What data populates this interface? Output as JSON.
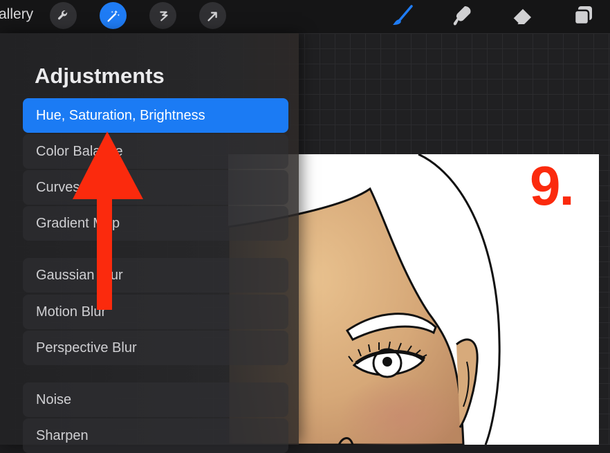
{
  "toolbar": {
    "gallery_label": "allery",
    "tools_left": [
      "wrench-icon",
      "magic-wand-icon",
      "selection-icon",
      "transform-arrow-icon"
    ],
    "tools_right": [
      "brush-icon",
      "smudge-icon",
      "eraser-icon",
      "layers-icon"
    ],
    "accent_color": "#1f7cf5"
  },
  "panel": {
    "title": "Adjustments",
    "items": [
      {
        "label": "Hue, Saturation, Brightness",
        "selected": true
      },
      {
        "label": "Color Balance"
      },
      {
        "label": "Curves"
      },
      {
        "label": "Gradient Map"
      },
      {
        "label": "Gaussian Blur"
      },
      {
        "label": "Motion Blur"
      },
      {
        "label": "Perspective Blur"
      },
      {
        "label": "Noise"
      },
      {
        "label": "Sharpen"
      }
    ]
  },
  "canvas": {
    "step_number": "9.",
    "step_color": "#fb2a0d",
    "annotation": "red-up-arrow"
  }
}
